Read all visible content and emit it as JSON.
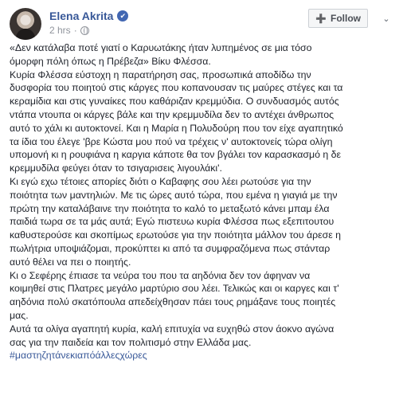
{
  "post": {
    "author": "Elena Akrita",
    "verified_badge": "✔",
    "time": "2 hrs",
    "separator": "·",
    "follow_icon": "➕",
    "follow_label": "Follow",
    "menu_icon": "⌄",
    "lines": [
      "«Δεν κατάλαβα ποτέ γιατί ο Καρυωτάκης ήταν λυπημένος σε μια τόσο",
      "όμορφη πόλη όπως η Πρέβεζα» Βίκυ Φλέσσα.",
      "Κυρία Φλέσσα εύστοχη η παρατήρηση σας, προσωπικά αποδίδω την",
      "δυσφορία του ποιητού στις κάργες που κοπανουσαν τις μαύρες στέγες και τα",
      "κεραμίδια και στις γυναίκες που καθάριζαν κρεμμύδια. Ο συνδυασμός αυτός",
      "ντάπα ντουπα οι κάργες βάλε και την κρεμμυδίλα δεν το αντέχει άνθρωπος",
      "αυτό το χάλι κι αυτοκτονεί. Και η Μαρία η Πολυδούρη που τον είχε αγαπητικό",
      "τα ίδια του έλεγε 'βρε Κώστα μου πού να τρέχεις ν' αυτοκτονείς τώρα ολίγη",
      "υπομονή κι η ρουφιάνα η καργια κάποτε θα τον βγάλει τον καρασκασμό η δε",
      "κρεμμυδίλα φεύγει όταν το τσιγαρισεις λιγουλάκι'.",
      "Κι εγώ εχω τέτοιες απορίες διότι ο Καβαφης σου λέει ρωτούσε για την",
      "ποιότητα των μαντηλιών. Με τις ώρες αυτό τώρα, που εμένα η γιαγιά με την",
      "πρώτη την καταλάβαινε την ποιότητα το καλό το μεταξωτό κάνει μπαμ έλα",
      "παιδιά τωρα σε τα μάς αυτά; Εγώ πιστευω κυρία Φλέσσα πως εξεπιτουτου",
      "καθυστερούσε και σκοπίμως ερωτούσε για την ποιότητα μάλλον του άρεσε η",
      "πωλήτρια υποψιάζομαι, προκύπτει κι από τα συμφραζόμενα πως στάνταρ",
      "αυτό θέλει να πει ο ποιητής.",
      "Κι ο Σεφέρης έπιασε τα νεύρα του που τα αηδόνια δεν τον άφηναν να",
      "κοιμηθεί στις Πλατρες μεγάλο μαρτύριο σου λέει. Τελικώς και οι καργες και τ'",
      "αηδόνια πολύ σκατόπουλα απεδείχθησαν πάει τους ρημάξανε τους ποιητές",
      "μας.",
      "Αυτά τα ολίγα αγαπητή κυρία, καλή επιτυχία να ευχηθώ στον άοκνο αγώνα",
      "σας για την παιδεία και τον πολιτισμό στην Ελλάδα μας."
    ],
    "hashtag": "#μαστηζητάνεκιαπόάλλεςχώρες"
  }
}
